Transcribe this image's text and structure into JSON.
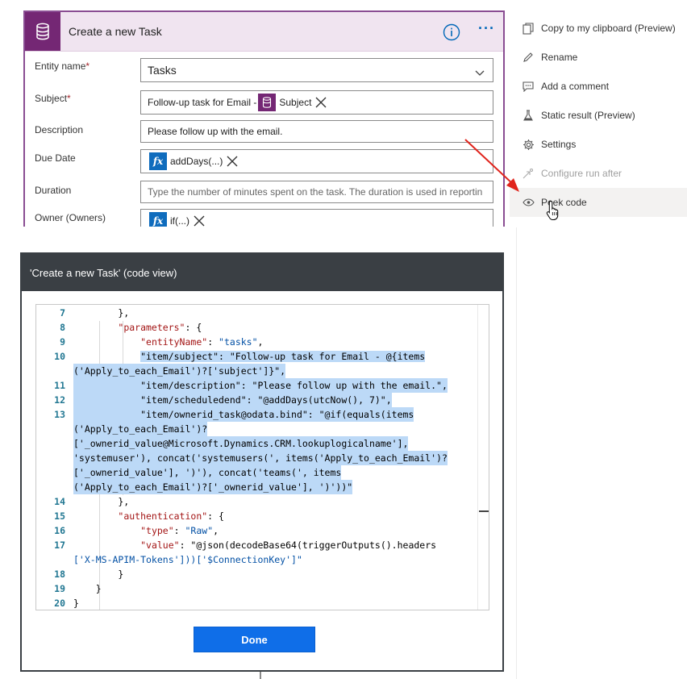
{
  "action_card": {
    "title": "Create a new Task",
    "icon": "database-icon",
    "info_icon": "info-icon",
    "more_icon": "ellipsis-icon",
    "more_label": "···",
    "accent_color": "#742774",
    "header_bg": "#f0e4f0",
    "fields": {
      "entity_name": {
        "label": "Entity name",
        "required": "*",
        "value": "Tasks"
      },
      "subject": {
        "label": "Subject",
        "required": "*",
        "prefix": "Follow-up task for Email -",
        "token": "Subject"
      },
      "description": {
        "label": "Description",
        "value": "Please follow up with the email."
      },
      "due_date": {
        "label": "Due Date",
        "token_fx": "fx",
        "token": "addDays(...)"
      },
      "duration": {
        "label": "Duration",
        "placeholder": "Type the number of minutes spent on the task. The duration is used in reportin"
      },
      "owner": {
        "label": "Owner (Owners)",
        "token_fx": "fx",
        "token": "if(...)"
      }
    }
  },
  "context_menu": {
    "items": [
      {
        "label": "Copy to my clipboard (Preview)",
        "icon": "copy-icon"
      },
      {
        "label": "Rename",
        "icon": "pencil-icon"
      },
      {
        "label": "Add a comment",
        "icon": "comment-icon"
      },
      {
        "label": "Static result (Preview)",
        "icon": "flask-icon"
      },
      {
        "label": "Settings",
        "icon": "gear-icon"
      },
      {
        "label": "Configure run after",
        "icon": "run-after-icon",
        "disabled": true
      },
      {
        "label": "Peek code",
        "icon": "eye-icon",
        "hovered": true
      }
    ]
  },
  "code_dialog": {
    "title": "'Create a new Task' (code view)",
    "done_label": "Done",
    "lines": [
      {
        "n": "7",
        "text": "        },"
      },
      {
        "n": "8",
        "text": "        \"parameters\": {"
      },
      {
        "n": "9",
        "text": "            \"entityName\": \"tasks\","
      },
      {
        "n": "10",
        "text": "            \"item/subject\": \"Follow-up task for Email - @{items"
      },
      {
        "n": "",
        "text": "('Apply_to_each_Email')?['subject']}\","
      },
      {
        "n": "11",
        "text": "            \"item/description\": \"Please follow up with the email.\","
      },
      {
        "n": "12",
        "text": "            \"item/scheduledend\": \"@addDays(utcNow(), 7)\","
      },
      {
        "n": "13",
        "text": "            \"item/ownerid_task@odata.bind\": \"@if(equals(items"
      },
      {
        "n": "",
        "text": "('Apply_to_each_Email')?"
      },
      {
        "n": "",
        "text": "['_ownerid_value@Microsoft.Dynamics.CRM.lookuplogicalname'],"
      },
      {
        "n": "",
        "text": "'systemuser'), concat('systemusers(', items('Apply_to_each_Email')?"
      },
      {
        "n": "",
        "text": "['_ownerid_value'], ')'), concat('teams(', items"
      },
      {
        "n": "",
        "text": "('Apply_to_each_Email')?['_ownerid_value'], ')'))\""
      },
      {
        "n": "14",
        "text": "        },"
      },
      {
        "n": "15",
        "text": "        \"authentication\": {"
      },
      {
        "n": "16",
        "text": "            \"type\": \"Raw\","
      },
      {
        "n": "17",
        "text": "            \"value\": \"@json(decodeBase64(triggerOutputs().headers"
      },
      {
        "n": "",
        "text": "['X-MS-APIM-Tokens']))['$ConnectionKey']\""
      },
      {
        "n": "18",
        "text": "        }"
      },
      {
        "n": "19",
        "text": "    }"
      },
      {
        "n": "20",
        "text": "}"
      }
    ]
  }
}
